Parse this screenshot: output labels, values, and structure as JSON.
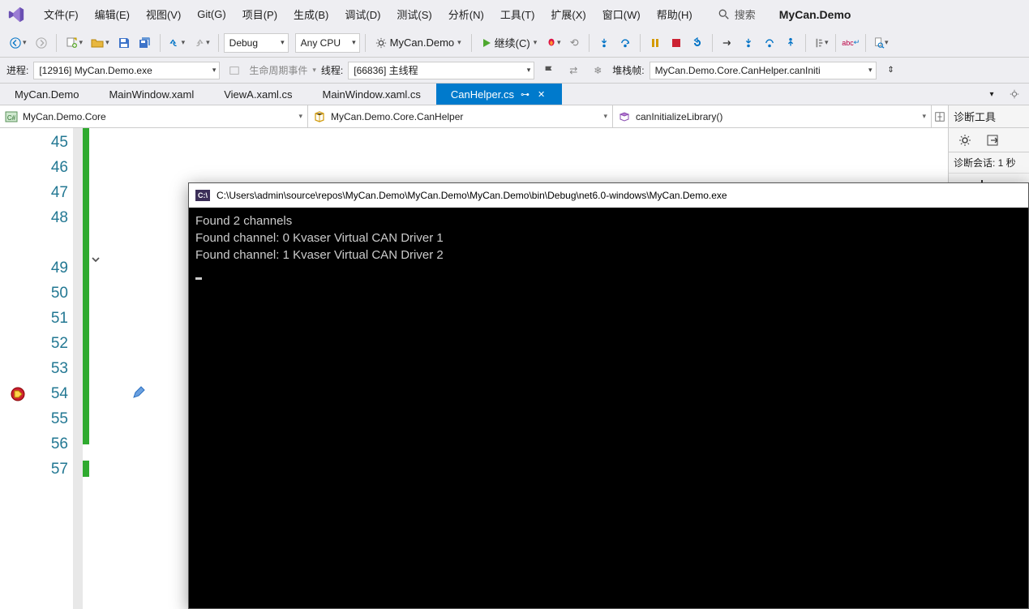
{
  "menu": {
    "file": "文件(F)",
    "edit": "编辑(E)",
    "view": "视图(V)",
    "git": "Git(G)",
    "project": "项目(P)",
    "build": "生成(B)",
    "debug": "调试(D)",
    "test": "测试(S)",
    "analyze": "分析(N)",
    "tools": "工具(T)",
    "ext": "扩展(X)",
    "window": "窗口(W)",
    "help": "帮助(H)"
  },
  "search": {
    "label": "搜索"
  },
  "title": "MyCan.Demo",
  "toolbar": {
    "config": "Debug",
    "platform": "Any CPU",
    "target": "MyCan.Demo",
    "continue": "继续(C)"
  },
  "debugbar": {
    "process_label": "进程:",
    "process_value": "[12916] MyCan.Demo.exe",
    "lifecycle": "生命周期事件",
    "thread_label": "线程:",
    "thread_value": "[66836] 主线程",
    "stack_label": "堆栈帧:",
    "stack_value": "MyCan.Demo.Core.CanHelper.canIniti"
  },
  "tabs": [
    {
      "label": "MyCan.Demo",
      "active": false
    },
    {
      "label": "MainWindow.xaml",
      "active": false
    },
    {
      "label": "ViewA.xaml.cs",
      "active": false
    },
    {
      "label": "MainWindow.xaml.cs",
      "active": false
    },
    {
      "label": "CanHelper.cs",
      "active": true
    }
  ],
  "nav": {
    "project": "MyCan.Demo.Core",
    "class": "MyCan.Demo.Core.CanHelper",
    "member": "canInitializeLibrary()"
  },
  "lines": [
    "45",
    "46",
    "47",
    "48",
    "",
    "49",
    "50",
    "51",
    "52",
    "53",
    "54",
    "55",
    "56",
    "57"
  ],
  "rightpanel": {
    "title": "诊断工具",
    "session": "诊断会话: 1 秒"
  },
  "console": {
    "title": "C:\\Users\\admin\\source\\repos\\MyCan.Demo\\MyCan.Demo\\MyCan.Demo\\bin\\Debug\\net6.0-windows\\MyCan.Demo.exe",
    "lines": [
      "Found 2 channels",
      "Found channel: 0 Kvaser Virtual CAN Driver 1",
      "Found channel: 1 Kvaser Virtual CAN Driver 2"
    ]
  }
}
